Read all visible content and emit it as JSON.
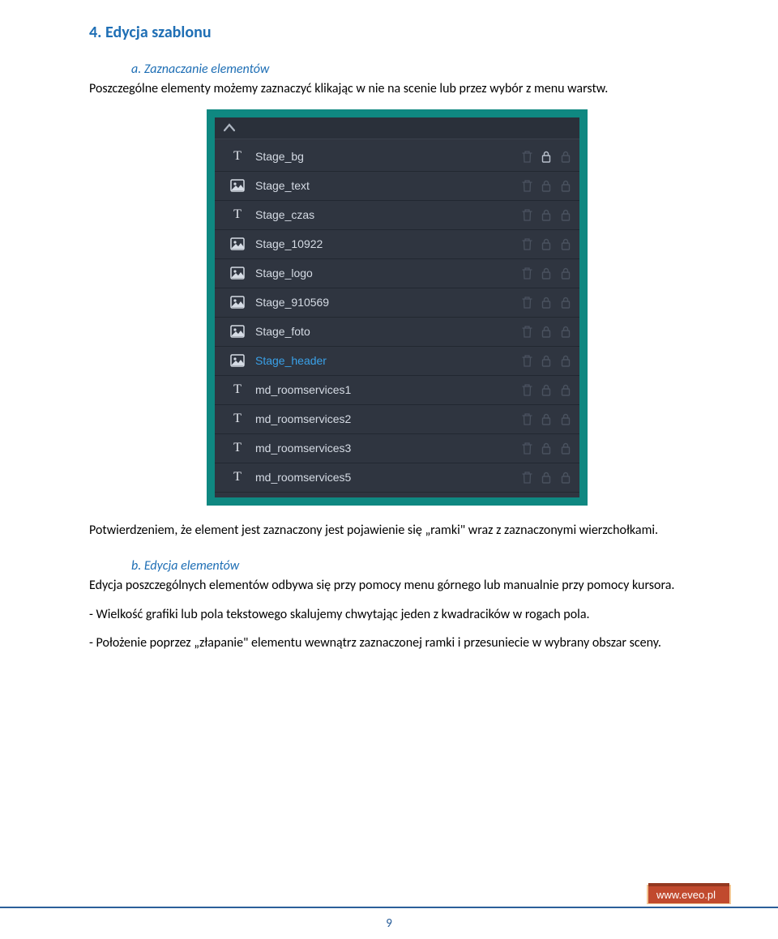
{
  "section": {
    "title": "4.  Edycja szablonu"
  },
  "sub_a": {
    "title": "a. Zaznaczanie elementów",
    "body": "Poszczególne elementy możemy zaznaczyć klikając w nie na scenie lub przez wybór z menu warstw."
  },
  "confirm_text": "Potwierdzeniem, że element jest zaznaczony jest pojawienie się „ramki\" wraz z zaznaczonymi wierzchołkami.",
  "sub_b": {
    "title": "b. Edycja elementów",
    "body": "Edycja poszczególnych elementów odbywa się przy pomocy menu górnego lub manualnie przy pomocy kursora.",
    "line1": "- Wielkość grafiki lub pola tekstowego skalujemy chwytając jeden z kwadracików w rogach pola.",
    "line2": "- Położenie poprzez „złapanie\" elementu wewnątrz zaznaczonej ramki i przesuniecie w wybrany obszar sceny."
  },
  "layers": [
    {
      "type": "T",
      "name": "Stage_bg",
      "trash": "dim",
      "lock": "active",
      "col3": "dim",
      "selected": false
    },
    {
      "type": "IMG",
      "name": "Stage_text",
      "trash": "dim",
      "lock": "dim",
      "col3": "dim",
      "selected": false
    },
    {
      "type": "T",
      "name": "Stage_czas",
      "trash": "dim",
      "lock": "dim",
      "col3": "dim",
      "selected": false
    },
    {
      "type": "IMG",
      "name": "Stage_10922",
      "trash": "dim",
      "lock": "dim",
      "col3": "dim",
      "selected": false
    },
    {
      "type": "IMG",
      "name": "Stage_logo",
      "trash": "dim",
      "lock": "dim",
      "col3": "dim",
      "selected": false
    },
    {
      "type": "IMG",
      "name": "Stage_910569",
      "trash": "dim",
      "lock": "dim",
      "col3": "dim",
      "selected": false
    },
    {
      "type": "IMG",
      "name": "Stage_foto",
      "trash": "dim",
      "lock": "dim",
      "col3": "dim",
      "selected": false
    },
    {
      "type": "IMG",
      "name": "Stage_header",
      "trash": "dim",
      "lock": "dim",
      "col3": "dim",
      "selected": true
    },
    {
      "type": "T",
      "name": "md_roomservices1",
      "trash": "dim",
      "lock": "dim",
      "col3": "dim",
      "selected": false
    },
    {
      "type": "T",
      "name": "md_roomservices2",
      "trash": "dim",
      "lock": "dim",
      "col3": "dim",
      "selected": false
    },
    {
      "type": "T",
      "name": "md_roomservices3",
      "trash": "dim",
      "lock": "dim",
      "col3": "dim",
      "selected": false
    },
    {
      "type": "T",
      "name": "md_roomservices5",
      "trash": "dim",
      "lock": "dim",
      "col3": "dim",
      "selected": false
    }
  ],
  "page_number": "9",
  "footer_site": "www.eveo.pl"
}
